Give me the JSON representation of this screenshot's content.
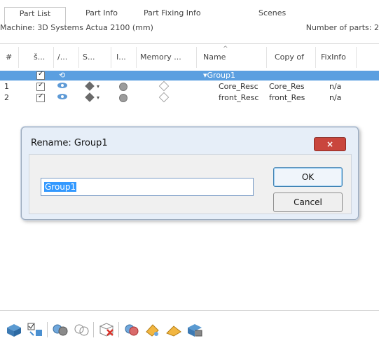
{
  "tabs": [
    {
      "label": "Part List"
    },
    {
      "label": "Part Info"
    },
    {
      "label": "Part Fixing Info"
    },
    {
      "label": "Scenes"
    }
  ],
  "machine": {
    "label": "Machine: 3D Systems Actua 2100 (mm)",
    "parts_label": "Number of parts: 2"
  },
  "table": {
    "headers": [
      "#",
      "š...",
      "/...",
      "S...",
      "Ⅰ...",
      "Memory ...",
      "Name",
      "Copy of",
      "FixInfo"
    ],
    "group": {
      "name": "▾Group1"
    },
    "rows": [
      {
        "num": "1",
        "name": "Core_Resc",
        "copy": "Core_Res",
        "fix": "n/a"
      },
      {
        "num": "2",
        "name": "front_Resc",
        "copy": "front_Res",
        "fix": "n/a"
      }
    ]
  },
  "dialog": {
    "title": "Rename: Group1",
    "close": "×",
    "input_value": "Group1",
    "ok": "OK",
    "cancel": "Cancel"
  },
  "toolbar": {
    "icons": [
      "parts-view-icon",
      "checklist-icon",
      "gears-icon",
      "gear-wire-icon",
      "delete-part-icon",
      "repair-icon",
      "paint-icon",
      "paint-fill-icon",
      "print-icon"
    ]
  }
}
